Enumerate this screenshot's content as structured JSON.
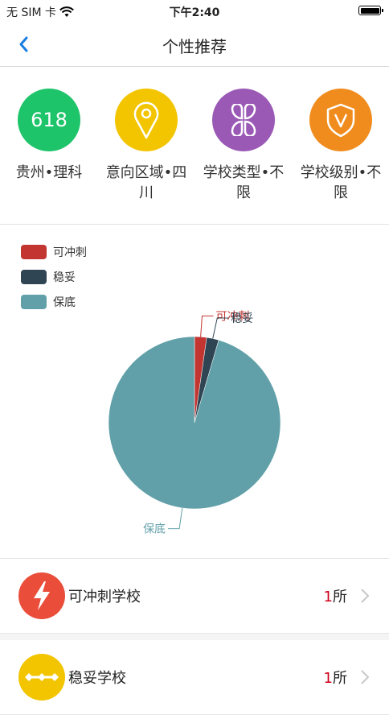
{
  "status": {
    "carrier": "无 SIM 卡",
    "time": "下午2:40"
  },
  "nav": {
    "title": "个性推荐"
  },
  "prefs": [
    {
      "icon_text": "618",
      "label": "贵州•理科",
      "color": "#1dc46a"
    },
    {
      "icon": "location-pin-icon",
      "label": "意向区域•四川",
      "color": "#f2c500"
    },
    {
      "icon": "four-petal-icon",
      "label": "学校类型•不限",
      "color": "#9b59b6"
    },
    {
      "icon": "shield-v-icon",
      "label": "学校级别•不限",
      "color": "#f08c1e"
    }
  ],
  "chart_data": {
    "type": "pie",
    "legend": [
      "可冲刺",
      "稳妥",
      "保底"
    ],
    "legend_position": "top-left",
    "series": [
      {
        "name": "可冲刺",
        "value": 1,
        "color": "#c23531"
      },
      {
        "name": "稳妥",
        "value": 1,
        "color": "#2f4554"
      },
      {
        "name": "保底",
        "value": 42,
        "color": "#61a0a8"
      }
    ]
  },
  "rows": [
    {
      "label": "可冲刺学校",
      "count": "1",
      "unit": "所",
      "color": "#ea4e3a",
      "icon": "lightning-icon"
    },
    {
      "label": "稳妥学校",
      "count": "1",
      "unit": "所",
      "color": "#f2c500",
      "icon": "balance-icon"
    }
  ]
}
